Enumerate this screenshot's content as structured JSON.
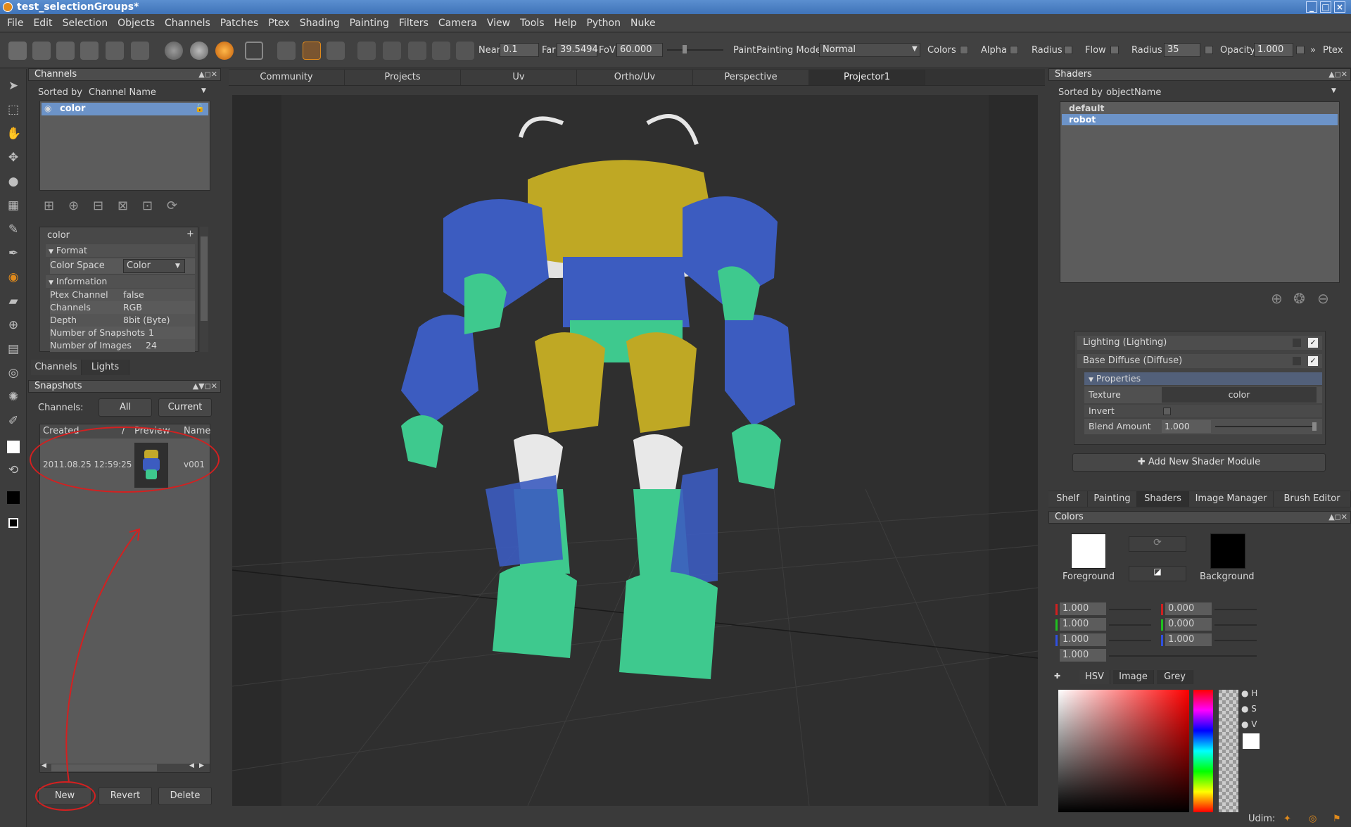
{
  "window": {
    "title": "test_selectionGroups*"
  },
  "menu": [
    "File",
    "Edit",
    "Selection",
    "Objects",
    "Channels",
    "Patches",
    "Ptex",
    "Shading",
    "Painting",
    "Filters",
    "Camera",
    "View",
    "Tools",
    "Help",
    "Python",
    "Nuke"
  ],
  "toolbar": {
    "near_label": "Near",
    "near_value": "0.1",
    "far_label": "Far",
    "far_value": "39.5494",
    "fov_label": "FoV",
    "fov_value": "60.000",
    "paint_label": "Paint",
    "painting_mode_label": "Painting Mode",
    "painting_mode_value": "Normal",
    "colors_label": "Colors",
    "alpha_label": "Alpha",
    "radius_label": "Radius",
    "flow_label": "Flow",
    "radius2_label": "Radius",
    "radius2_value": "35",
    "opacity_label": "Opacity",
    "opacity_value": "1.000",
    "overflow": "»",
    "ptex_label": "Ptex"
  },
  "channels_panel": {
    "title": "Channels",
    "sorted_by_label": "Sorted by",
    "sorted_by_value": "Channel Name",
    "channel_name": "color",
    "group_title": "color",
    "format_label": "Format",
    "color_space_label": "Color Space",
    "color_space_value": "Color",
    "information_label": "Information",
    "info": [
      {
        "k": "Ptex Channel",
        "v": "false"
      },
      {
        "k": "Channels",
        "v": "RGB"
      },
      {
        "k": "Depth",
        "v": "8bit  (Byte)"
      },
      {
        "k": "Number of Snapshots",
        "v": "1"
      },
      {
        "k": "Number of Images",
        "v": "24"
      }
    ],
    "tabs": [
      "Channels",
      "Lights"
    ]
  },
  "snapshots_panel": {
    "title": "Snapshots",
    "channels_label": "Channels:",
    "all_button": "All",
    "current_button": "Current",
    "col_created": "Created",
    "col_preview": "Preview",
    "col_name": "Name",
    "rows": [
      {
        "created": "2011.08.25 12:59:25",
        "name": "v001"
      }
    ],
    "new_button": "New",
    "revert_button": "Revert",
    "delete_button": "Delete"
  },
  "view_tabs": [
    "Community",
    "Projects",
    "Uv",
    "Ortho/Uv",
    "Perspective",
    "Projector1"
  ],
  "shaders_panel": {
    "title": "Shaders",
    "sorted_by_label": "Sorted by",
    "sorted_by_value": "objectName",
    "items": [
      "default",
      "robot"
    ],
    "modules": [
      {
        "label": "Lighting (Lighting)"
      },
      {
        "label": "Base Diffuse (Diffuse)"
      }
    ],
    "properties_label": "Properties",
    "texture_label": "Texture",
    "texture_value": "color",
    "invert_label": "Invert",
    "blend_label": "Blend Amount",
    "blend_value": "1.000",
    "add_module_button": "Add New Shader Module"
  },
  "right_tabs": [
    "Shelf",
    "Painting",
    "Shaders",
    "Image Manager",
    "Brush Editor"
  ],
  "colors_panel": {
    "title": "Colors",
    "foreground_label": "Foreground",
    "background_label": "Background",
    "fg_values": [
      "1.000",
      "1.000",
      "1.000",
      "1.000"
    ],
    "bg_values": [
      "0.000",
      "0.000",
      "1.000"
    ],
    "picker_tabs": [
      "HSV",
      "Image",
      "Grey"
    ],
    "hsv": [
      "H",
      "S",
      "V"
    ]
  },
  "status": {
    "udim_label": "Udim:"
  },
  "colors": {
    "accent": "#5b8fd0",
    "selection": "#6c93c8",
    "annotation": "#d42020"
  }
}
